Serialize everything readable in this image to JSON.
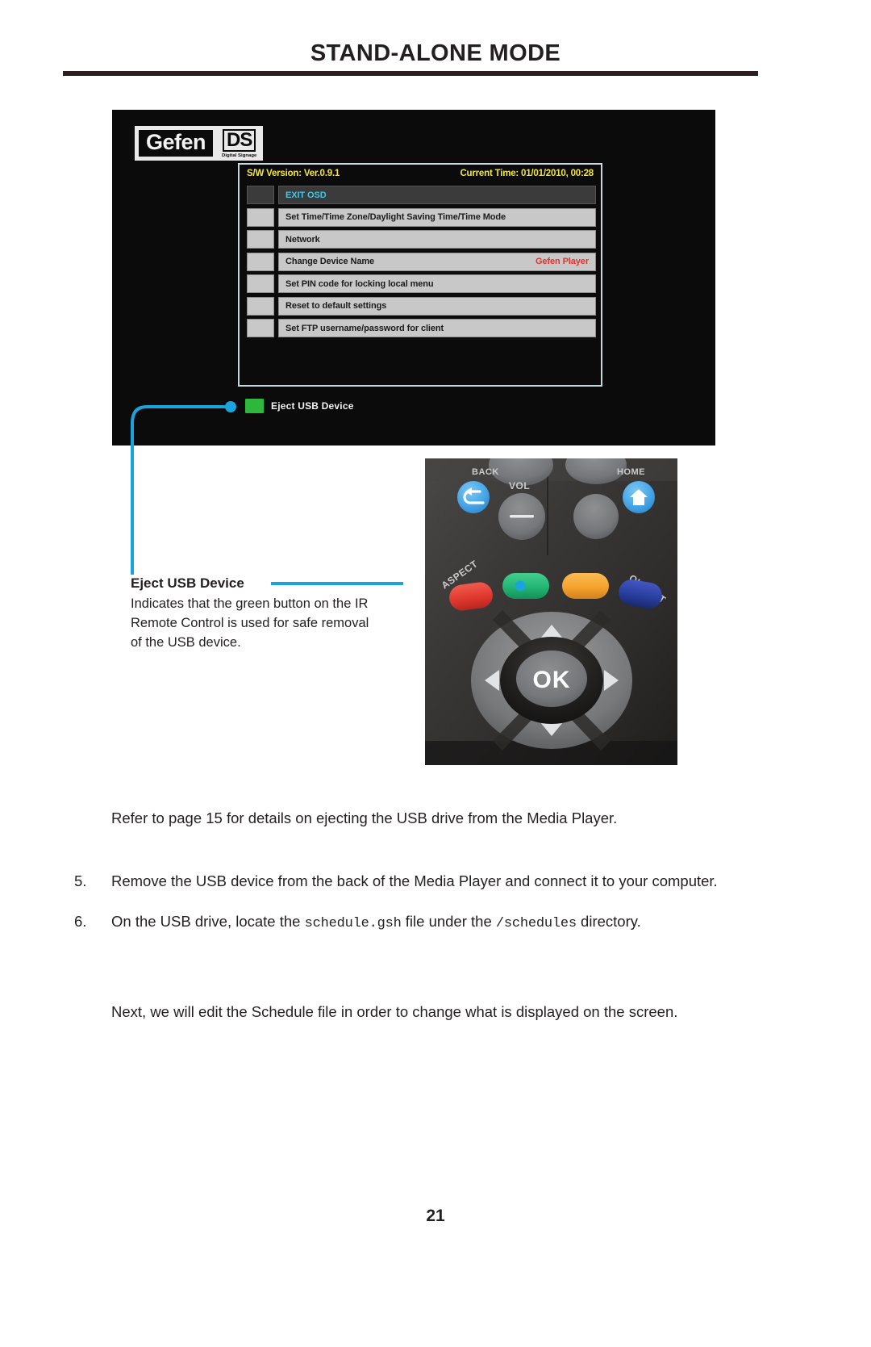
{
  "header": {
    "title": "STAND-ALONE MODE"
  },
  "osd": {
    "logo": {
      "brand": "Gefen",
      "product": "DS",
      "tagline": "Digital Signage"
    },
    "status": {
      "sw_version": "S/W Version: Ver.0.9.1",
      "current_time": "Current Time: 01/01/2010, 00:28"
    },
    "menu_items": [
      {
        "label": "EXIT OSD",
        "value": "",
        "selected": true
      },
      {
        "label": "Set Time/Time Zone/Daylight Saving Time/Time Mode",
        "value": "",
        "selected": false
      },
      {
        "label": "Network",
        "value": "",
        "selected": false
      },
      {
        "label": "Change Device Name",
        "value": "Gefen Player",
        "selected": false
      },
      {
        "label": "Set PIN code for locking local menu",
        "value": "",
        "selected": false
      },
      {
        "label": "Reset to default settings",
        "value": "",
        "selected": false
      },
      {
        "label": "Set FTP username/password for client",
        "value": "",
        "selected": false
      }
    ],
    "eject_row": {
      "label": "Eject USB Device",
      "swatch_color": "#2db83d"
    }
  },
  "callout": {
    "title": "Eject USB Device",
    "body": "Indicates that the green button on the IR Remote Control is used for safe removal of the USB device.",
    "line_color": "#1ba3de"
  },
  "remote": {
    "labels": {
      "back": "BACK",
      "home": "HOME",
      "vol": "VOL",
      "aspect": "ASPECT",
      "output": "OUTPUT",
      "ok": "OK"
    },
    "button_colors": {
      "red": "#e0392f",
      "green": "#22b573",
      "orange": "#f4a22c",
      "blue": "#2a3f9e",
      "nav_blue": "#4aa8e8"
    }
  },
  "body": {
    "refer_paragraph": "Refer to page 15 for details on ejecting the USB drive from the Media Player.",
    "steps": [
      {
        "number": "5.",
        "text_parts": [
          {
            "type": "text",
            "value": "Remove the USB device from the back of the Media Player and connect it to your computer."
          }
        ]
      },
      {
        "number": "6.",
        "text_parts": [
          {
            "type": "text",
            "value": "On the USB drive, locate the "
          },
          {
            "type": "mono",
            "value": "schedule.gsh"
          },
          {
            "type": "text",
            "value": " file under the "
          },
          {
            "type": "mono",
            "value": "/schedules"
          },
          {
            "type": "text",
            "value": " directory."
          }
        ]
      }
    ],
    "step5_text": "Remove the USB device from the back of the Media Player and connect it to your computer.",
    "step6_lead": "On the USB drive, locate the ",
    "step6_file": "schedule.gsh",
    "step6_mid": " file under the ",
    "step6_dir": "/schedules",
    "step6_tail": " directory.",
    "next_paragraph": "Next, we will edit the Schedule file in order to change what is displayed on the screen."
  },
  "footer": {
    "page_number": "21"
  }
}
